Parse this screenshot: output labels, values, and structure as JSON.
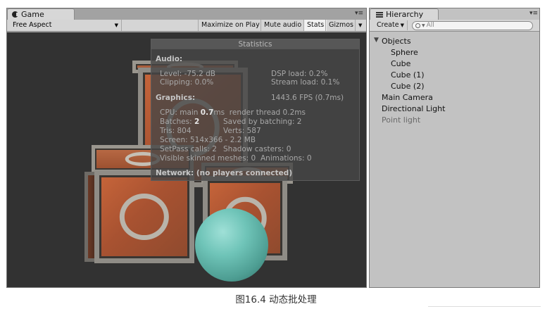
{
  "game": {
    "tab_title": "Game",
    "tab_icon": "pacman-icon",
    "aspect": "Free Aspect",
    "buttons": [
      "Maximize on Play",
      "Mute audio",
      "Stats",
      "Gizmos"
    ],
    "active_button": "Stats"
  },
  "stats": {
    "title": "Statistics",
    "audio_header": "Audio:",
    "level_label": "Level: ",
    "level_value": "-75.2 dB",
    "clipping_label": "Clipping: ",
    "clipping_value": "0.0%",
    "dsp_label": "DSP load: ",
    "dsp_value": "0.2%",
    "stream_label": "Stream load: ",
    "stream_value": "0.1%",
    "graphics_header": "Graphics:",
    "fps": "1443.6 FPS (0.7ms)",
    "cpu_main_label": "CPU: main ",
    "cpu_main_value": "0.7",
    "cpu_main_unit": "ms",
    "render_thread_label": "render thread ",
    "render_thread_value": "0.2ms",
    "batches_label": "Batches: ",
    "batches_value": "2",
    "saved_label": "Saved by batching: ",
    "saved_value": "2",
    "tris_label": "Tris: ",
    "tris_value": "804",
    "verts_label": "Verts: ",
    "verts_value": "587",
    "screen_label": "Screen: ",
    "screen_value": "514x366 - 2.2 MB",
    "setpass_label": "SetPass calls: ",
    "setpass_value": "2",
    "shadow_label": "Shadow casters: ",
    "shadow_value": "0",
    "skinned_label": "Visible skinned meshes: ",
    "skinned_value": "0",
    "animations_label": "Animations: ",
    "animations_value": "0",
    "network": "Network: (no players connected)"
  },
  "hierarchy": {
    "tab_title": "Hierarchy",
    "create_label": "Create",
    "search_placeholder": "All",
    "items": [
      {
        "label": "Objects",
        "expanded": true
      },
      {
        "label": "Sphere"
      },
      {
        "label": "Cube"
      },
      {
        "label": "Cube (1)"
      },
      {
        "label": "Cube (2)"
      },
      {
        "label": "Main Camera"
      },
      {
        "label": "Directional Light"
      },
      {
        "label": "Point light",
        "inactive": true
      }
    ]
  },
  "caption": "图16.4 动态批处理"
}
